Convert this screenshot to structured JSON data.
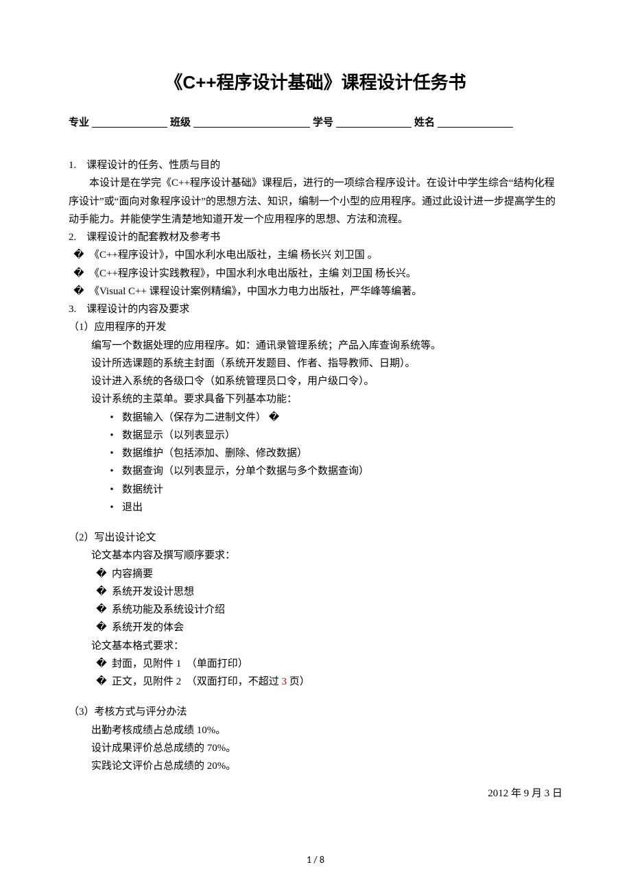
{
  "title": "《C++程序设计基础》课程设计任务书",
  "info": {
    "major_label": "专业",
    "class_label": "班级",
    "id_label": "学号",
    "name_label": "姓名"
  },
  "s1": {
    "head": "1.　课程设计的任务、性质与目的",
    "p1": "本设计是在学完《C++程序设计基础》课程后，进行的一项综合程序设计。在设计中学生综合“结构化程序设计”或“面向对象程序设计”的思想方法、知识，编制一个小型的应用程序。通过此设计进一步提高学生的动手能力。并能使学生清楚地知道开发一个应用程序的思想、方法和流程。"
  },
  "s2": {
    "head": "2.　课程设计的配套教材及参考书",
    "b1": "《C++程序设计》，中国水利水电出版社，主编 杨长兴 刘卫国 。",
    "b2": "《C++程序设计实践教程》，中国水利水电出版社，主编 刘卫国 杨长兴。",
    "b3": "《Visual C++  课程设计案例精编》，中国水力电力出版社，严华峰等编著。"
  },
  "s3": {
    "head": "3.　课程设计的内容及要求",
    "part1_title": "（1）应用程序的开发",
    "part1_l1": "编写一个数据处理的应用程序。如：通讯录管理系统；产品入库查询系统等。",
    "part1_l2": "设计所选课题的系统主封面（系统开发题目、作者、指导教师、日期）。",
    "part1_l3": "设计进入系统的各级口令（如系统管理员口令，用户级口令）。",
    "part1_l4": "设计系统的主菜单。要求具备下列基本功能：",
    "func1": "数据输入（保存为二进制文件）",
    "func2": "数据显示（以列表显示）",
    "func3": "数据维护（包括添加、删除、修改数据）",
    "func4": "数据查询（以列表显示，分单个数据与多个数据查询）",
    "func5": "数据统计",
    "func6": "退出",
    "part2_title": "（2）写出设计论文",
    "part2_l1": "论文基本内容及撰写顺序要求：",
    "paper1": "内容摘要",
    "paper2": "系统开发设计思想",
    "paper3": "系统功能及系统设计介绍",
    "paper4": "系统开发的体会",
    "part2_l2": "论文基本格式要求：",
    "fmt1_a": "封面，见附件 1　（单面打印）",
    "fmt2_a": "正文，见附件 2　（双面打印，不超过 ",
    "fmt2_red": "3",
    "fmt2_b": " 页）",
    "part3_title": "（3）考核方式与评分办法",
    "grade1": "出勤考核成绩占总成绩 10%。",
    "grade2": "设计成果评价总总成绩的 70%。",
    "grade3": "实践论文评价占总成绩的 20%。"
  },
  "date": "2012 年 9 月 3 日",
  "page_num": "1  /  8",
  "marker": "�"
}
